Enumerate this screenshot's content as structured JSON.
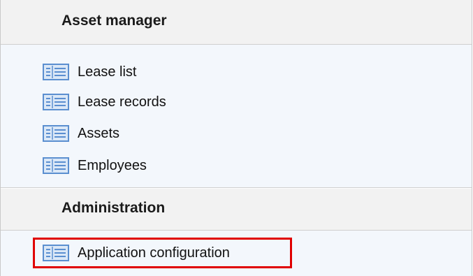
{
  "sections": [
    {
      "title": "Asset manager",
      "items": [
        {
          "label": "Lease list",
          "icon": "list-view-icon"
        },
        {
          "label": "Lease records",
          "icon": "list-view-icon"
        },
        {
          "label": "Assets",
          "icon": "list-view-icon"
        },
        {
          "label": "Employees",
          "icon": "list-view-icon"
        }
      ]
    },
    {
      "title": "Administration",
      "items": [
        {
          "label": "Application configuration",
          "icon": "list-view-icon"
        }
      ]
    }
  ],
  "colors": {
    "highlight_border": "#e00000",
    "icon_blue": "#5b8fd0",
    "header_bg": "#f2f2f2",
    "body_bg": "#f3f7fc"
  }
}
